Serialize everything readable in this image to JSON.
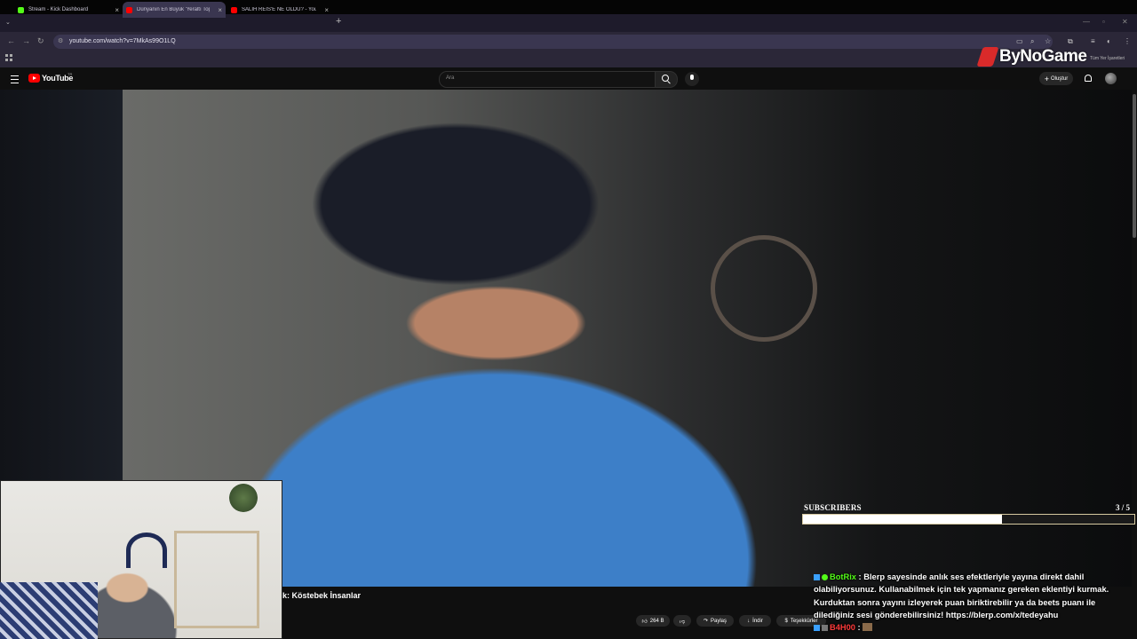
{
  "browser": {
    "tabs": [
      {
        "title": "Stream - Kick Dashboard",
        "favicon_color": "#53fc18",
        "active": false
      },
      {
        "title": "Dünyanın En Büyük 'Yeraltı Top",
        "favicon_color": "#ff0000",
        "active": true
      },
      {
        "title": "SALİH REİS'E NE OLDU? - YouTu",
        "favicon_color": "#ff0000",
        "active": false
      }
    ],
    "url": "youtube.com/watch?v=7MkAs99O1LQ",
    "bookmarks_all": "Tüm Yer İşaretleri",
    "icons": [
      "tab-search-icon",
      "back-icon",
      "forward-icon",
      "reload-icon",
      "site-info-icon",
      "cast-icon",
      "zoom-icon",
      "star-icon",
      "extensions-icon",
      "profile-icon",
      "menu-icon",
      "apps-icon"
    ]
  },
  "overlay_brand": "ByNoGame",
  "youtube": {
    "logo_text": "YouTube",
    "country_code": "TR",
    "search_placeholder": "Ara",
    "create_label": "Oluştur",
    "video_title": "k: Köstebek İnsanlar",
    "actions": {
      "likes": "264 B",
      "share": "Paylaş",
      "download": "İndir",
      "thanks": "Teşekkürler"
    }
  },
  "stream_overlay": {
    "subscribers_label": "SUBSCRIBERS",
    "subscribers_count": "3 / 5",
    "subscribers_progress": 0.6,
    "chat": [
      {
        "user": "BotRix",
        "user_color": "#53fc18",
        "message": "Blerp sayesinde anlık ses efektleriyle yayına direkt dahil olabiliyorsunuz. Kullanabilmek için tek yapmanız gereken eklentiyi kurmak. Kurduktan sonra yayını izleyerek puan biriktirebilir ya da beets puanı ile dilediğiniz sesi gönderebilirsiniz! https://blerp.com/x/tedeyahu"
      },
      {
        "user": "B4H00",
        "user_color": "#ff3a3a",
        "message": ""
      }
    ]
  }
}
